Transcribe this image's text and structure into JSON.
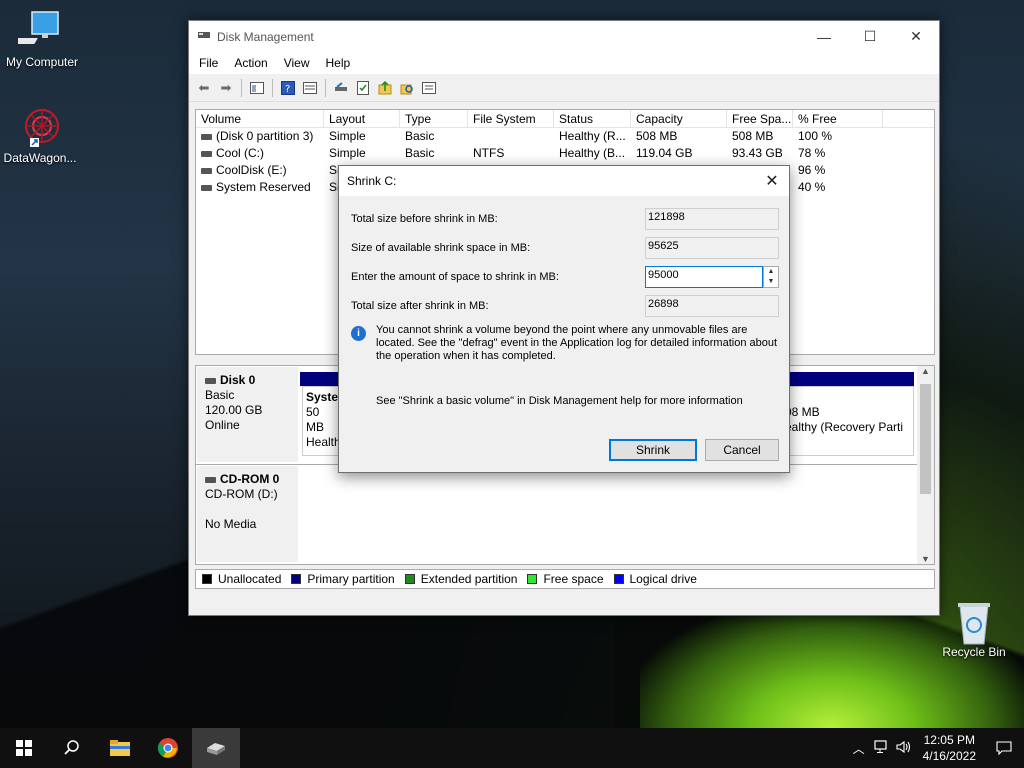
{
  "desktop": {
    "icons": [
      {
        "label": "My Computer"
      },
      {
        "label": "DataWagon..."
      },
      {
        "label": "Recycle Bin"
      }
    ]
  },
  "window": {
    "title": "Disk Management",
    "menu": [
      "File",
      "Action",
      "View",
      "Help"
    ],
    "volume_table": {
      "columns": [
        "Volume",
        "Layout",
        "Type",
        "File System",
        "Status",
        "Capacity",
        "Free Spa...",
        "% Free"
      ],
      "rows": [
        [
          "(Disk 0 partition 3)",
          "Simple",
          "Basic",
          "",
          "Healthy (R...",
          "508 MB",
          "508 MB",
          "100 %"
        ],
        [
          "Cool (C:)",
          "Simple",
          "Basic",
          "NTFS",
          "Healthy (B...",
          "119.04 GB",
          "93.43 GB",
          "78 %"
        ],
        [
          "CoolDisk (E:)",
          "Si",
          "",
          "",
          "",
          "",
          "",
          "96 %"
        ],
        [
          "System Reserved",
          "Si",
          "",
          "",
          "",
          "",
          "",
          "40 %"
        ]
      ]
    },
    "disks": [
      {
        "name": "Disk 0",
        "type": "Basic",
        "size": "120.00 GB",
        "state": "Online",
        "partitions": [
          {
            "name": "Syster",
            "size": "50 MB",
            "status": "Health"
          },
          {
            "size": "08 MB",
            "status": "ealthy (Recovery Parti"
          }
        ]
      },
      {
        "name": "CD-ROM 0",
        "type": "CD-ROM (D:)",
        "state": "No Media"
      }
    ],
    "legend": [
      {
        "label": "Unallocated",
        "color": "#000000"
      },
      {
        "label": "Primary partition",
        "color": "#00007f"
      },
      {
        "label": "Extended partition",
        "color": "#1f8a1f"
      },
      {
        "label": "Free space",
        "color": "#33e633"
      },
      {
        "label": "Logical drive",
        "color": "#0000ff"
      }
    ]
  },
  "dialog": {
    "title": "Shrink C:",
    "total_before_label": "Total size before shrink in MB:",
    "total_before_value": "121898",
    "available_label": "Size of available shrink space in MB:",
    "available_value": "95625",
    "amount_label": "Enter the amount of space to shrink in MB:",
    "amount_value": "95000",
    "total_after_label": "Total size after shrink in MB:",
    "total_after_value": "26898",
    "info_text": "You cannot shrink a volume beyond the point where any unmovable files are located. See the \"defrag\" event in the Application log for detailed information about the operation when it has completed.",
    "help_text": "See \"Shrink a basic volume\" in Disk Management help for more information",
    "shrink_label": "Shrink",
    "cancel_label": "Cancel"
  },
  "taskbar": {
    "time": "12:05 PM",
    "date": "4/16/2022"
  }
}
